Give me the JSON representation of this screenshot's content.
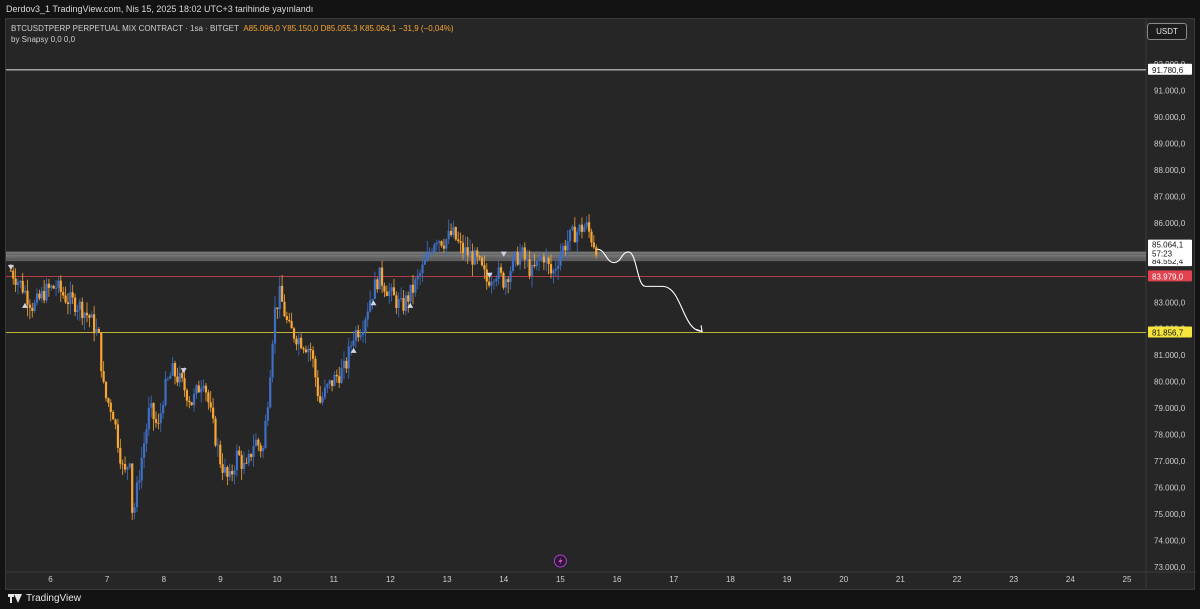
{
  "header": {
    "publish_line": "Derdov3_1 TradingView.com, Nis 15, 2025 18:02 UTC+3 tarihinde yayınlandı"
  },
  "legend": {
    "symbol_line": "BTCUSDTPERP PERPETUAL MIX CONTRACT · 1sa · BITGET",
    "ohlc": "A85.096,0  Y85.150,0  D85.055,3  K85.064,1  −31,9 (−0,04%)",
    "indicator": "by Snapsy  0,0  0,0"
  },
  "currency_button": "USDT",
  "brand": "TradingView",
  "colors": {
    "up_candle": "#3f6fc4",
    "down_candle": "#f7a534",
    "background": "#262626",
    "resistance_line": "#cfcfcf",
    "red_level": "#e0434f",
    "yellow_level": "#f5e53c",
    "zone": "#8c8c8c"
  },
  "chart_data": {
    "type": "candlestick",
    "symbol": "BTCUSDTPERP",
    "timeframe": "1sa",
    "exchange": "BITGET",
    "y_range": [
      73000,
      93000
    ],
    "y_ticks": [
      "73.000,0",
      "74.000,0",
      "75.000,0",
      "76.000,0",
      "77.000,0",
      "78.000,0",
      "79.000,0",
      "80.000,0",
      "81.000,0",
      "82.000,0",
      "83.000,0",
      "84.000,0",
      "85.000,0",
      "86.000,0",
      "87.000,0",
      "88.000,0",
      "89.000,0",
      "90.000,0",
      "91.000,0",
      "92.000,0"
    ],
    "x_ticks": [
      "6",
      "7",
      "8",
      "9",
      "10",
      "11",
      "12",
      "13",
      "14",
      "15",
      "16",
      "17",
      "18",
      "19",
      "20",
      "21",
      "22",
      "23",
      "24",
      "25"
    ],
    "x_range_days": [
      5.25,
      25.3
    ],
    "price_path": [
      [
        5.3,
        84.2
      ],
      [
        5.5,
        83.6
      ],
      [
        5.7,
        82.8
      ],
      [
        5.9,
        83.4
      ],
      [
        6.1,
        83.6
      ],
      [
        6.3,
        83.1
      ],
      [
        6.5,
        82.9
      ],
      [
        6.7,
        82.4
      ],
      [
        6.85,
        81.7
      ],
      [
        6.95,
        79.5
      ],
      [
        7.1,
        78.9
      ],
      [
        7.3,
        76.4
      ],
      [
        7.4,
        77.2
      ],
      [
        7.45,
        74.8
      ],
      [
        7.6,
        77.0
      ],
      [
        7.75,
        79.0
      ],
      [
        7.9,
        78.2
      ],
      [
        8.0,
        79.6
      ],
      [
        8.15,
        80.4
      ],
      [
        8.3,
        80.0
      ],
      [
        8.5,
        79.2
      ],
      [
        8.7,
        80.2
      ],
      [
        8.85,
        78.5
      ],
      [
        9.0,
        77.0
      ],
      [
        9.15,
        76.2
      ],
      [
        9.3,
        77.3
      ],
      [
        9.45,
        76.6
      ],
      [
        9.6,
        77.8
      ],
      [
        9.75,
        77.4
      ],
      [
        9.85,
        79.7
      ],
      [
        9.95,
        82.6
      ],
      [
        10.05,
        83.3
      ],
      [
        10.2,
        82.0
      ],
      [
        10.4,
        81.6
      ],
      [
        10.6,
        81.2
      ],
      [
        10.75,
        79.2
      ],
      [
        10.9,
        79.8
      ],
      [
        11.05,
        80.2
      ],
      [
        11.2,
        80.5
      ],
      [
        11.35,
        81.8
      ],
      [
        11.5,
        82.1
      ],
      [
        11.65,
        83.2
      ],
      [
        11.8,
        84.0
      ],
      [
        12.0,
        83.3
      ],
      [
        12.2,
        82.8
      ],
      [
        12.4,
        83.5
      ],
      [
        12.6,
        84.4
      ],
      [
        12.8,
        85.5
      ],
      [
        12.95,
        85.3
      ],
      [
        13.1,
        85.6
      ],
      [
        13.25,
        85.0
      ],
      [
        13.4,
        84.8
      ],
      [
        13.55,
        84.5
      ],
      [
        13.7,
        83.8
      ],
      [
        13.85,
        84.2
      ],
      [
        14.0,
        83.8
      ],
      [
        14.15,
        84.4
      ],
      [
        14.3,
        84.9
      ],
      [
        14.5,
        84.1
      ],
      [
        14.7,
        84.8
      ],
      [
        14.85,
        84.0
      ],
      [
        15.0,
        84.9
      ],
      [
        15.15,
        85.4
      ],
      [
        15.3,
        85.7
      ],
      [
        15.45,
        85.9
      ],
      [
        15.6,
        85.2
      ],
      [
        15.65,
        85.06
      ]
    ],
    "levels": [
      {
        "name": "resistance",
        "value": 91780.6,
        "label": "91.780,6",
        "color": "#cfcfcf"
      },
      {
        "name": "zone_top",
        "value": 84920,
        "color": "#8c8c8c"
      },
      {
        "name": "zone_bottom",
        "value": 84552.4,
        "label": "84.552,4",
        "color": "#8c8c8c"
      },
      {
        "name": "red_level",
        "value": 83979.0,
        "label": "83.979,0",
        "color": "#e0434f"
      },
      {
        "name": "yellow_level",
        "value": 81856.7,
        "label": "81.856,7",
        "color": "#f5e53c"
      }
    ],
    "last_price": {
      "value": 85064.1,
      "label": "85.064,1",
      "countdown": "57:23"
    },
    "projection": [
      [
        15.65,
        85.0
      ],
      [
        15.95,
        84.5
      ],
      [
        16.2,
        84.9
      ],
      [
        16.5,
        83.6
      ],
      [
        16.8,
        83.6
      ],
      [
        17.5,
        81.9
      ]
    ]
  }
}
